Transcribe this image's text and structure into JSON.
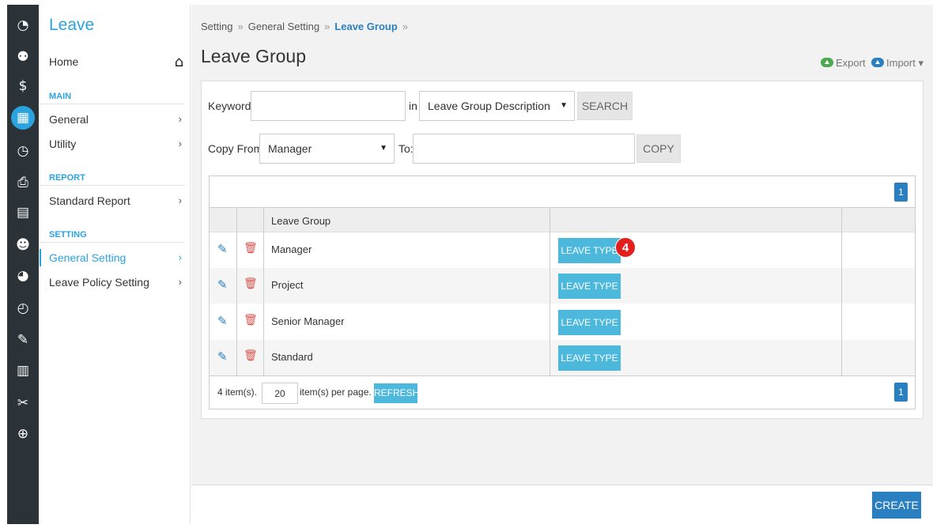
{
  "rail": {
    "icons": [
      "dashboard-icon",
      "users-icon",
      "payroll-icon",
      "leave-calendar-icon",
      "clock-icon",
      "claim-icon",
      "schedule-icon",
      "profile-icon",
      "chart-icon",
      "timer-icon",
      "form-icon",
      "table-icon",
      "tools-icon",
      "upload-icon"
    ],
    "active": "leave-calendar-icon"
  },
  "sidebar": {
    "app_title": "Leave",
    "home": "Home",
    "sections": [
      {
        "title": "MAIN",
        "items": [
          "General",
          "Utility"
        ]
      },
      {
        "title": "REPORT",
        "items": [
          "Standard Report"
        ]
      },
      {
        "title": "SETTING",
        "items": [
          "General Setting",
          "Leave Policy Setting"
        ]
      }
    ],
    "active_item": "General Setting"
  },
  "breadcrumb": {
    "items": [
      "Setting",
      "General Setting",
      "Leave Group"
    ],
    "sep": "»"
  },
  "page_title": "Leave Group",
  "toolbar": {
    "export": "Export",
    "import": "Import ▾"
  },
  "search": {
    "keyword_label": "Keyword:",
    "keyword_value": "",
    "in_label": "in",
    "field_select": "Leave Group Description",
    "search_button": "SEARCH"
  },
  "copy": {
    "from_label": "Copy From:",
    "from_select": "Manager",
    "to_label": "To:",
    "to_value": "",
    "copy_button": "COPY"
  },
  "grid": {
    "page": "1",
    "column_header": "Leave Group",
    "rows": [
      {
        "name": "Manager",
        "button": "LEAVE TYPE"
      },
      {
        "name": "Project",
        "button": "LEAVE TYPE"
      },
      {
        "name": "Senior Manager",
        "button": "LEAVE TYPE"
      },
      {
        "name": "Standard",
        "button": "LEAVE TYPE"
      }
    ],
    "step_badge": "4",
    "footer": {
      "count": "4 item(s).",
      "per_page_value": "20",
      "per_page_label": "item(s) per page.",
      "refresh": "REFRESH",
      "page": "1"
    }
  },
  "footer": {
    "create": "CREATE"
  },
  "colors": {
    "accent": "#2aa3df",
    "primary": "#2a7fc0",
    "button": "#4bb8dc",
    "rail": "#2b3238",
    "badge": "#e31e1e"
  }
}
